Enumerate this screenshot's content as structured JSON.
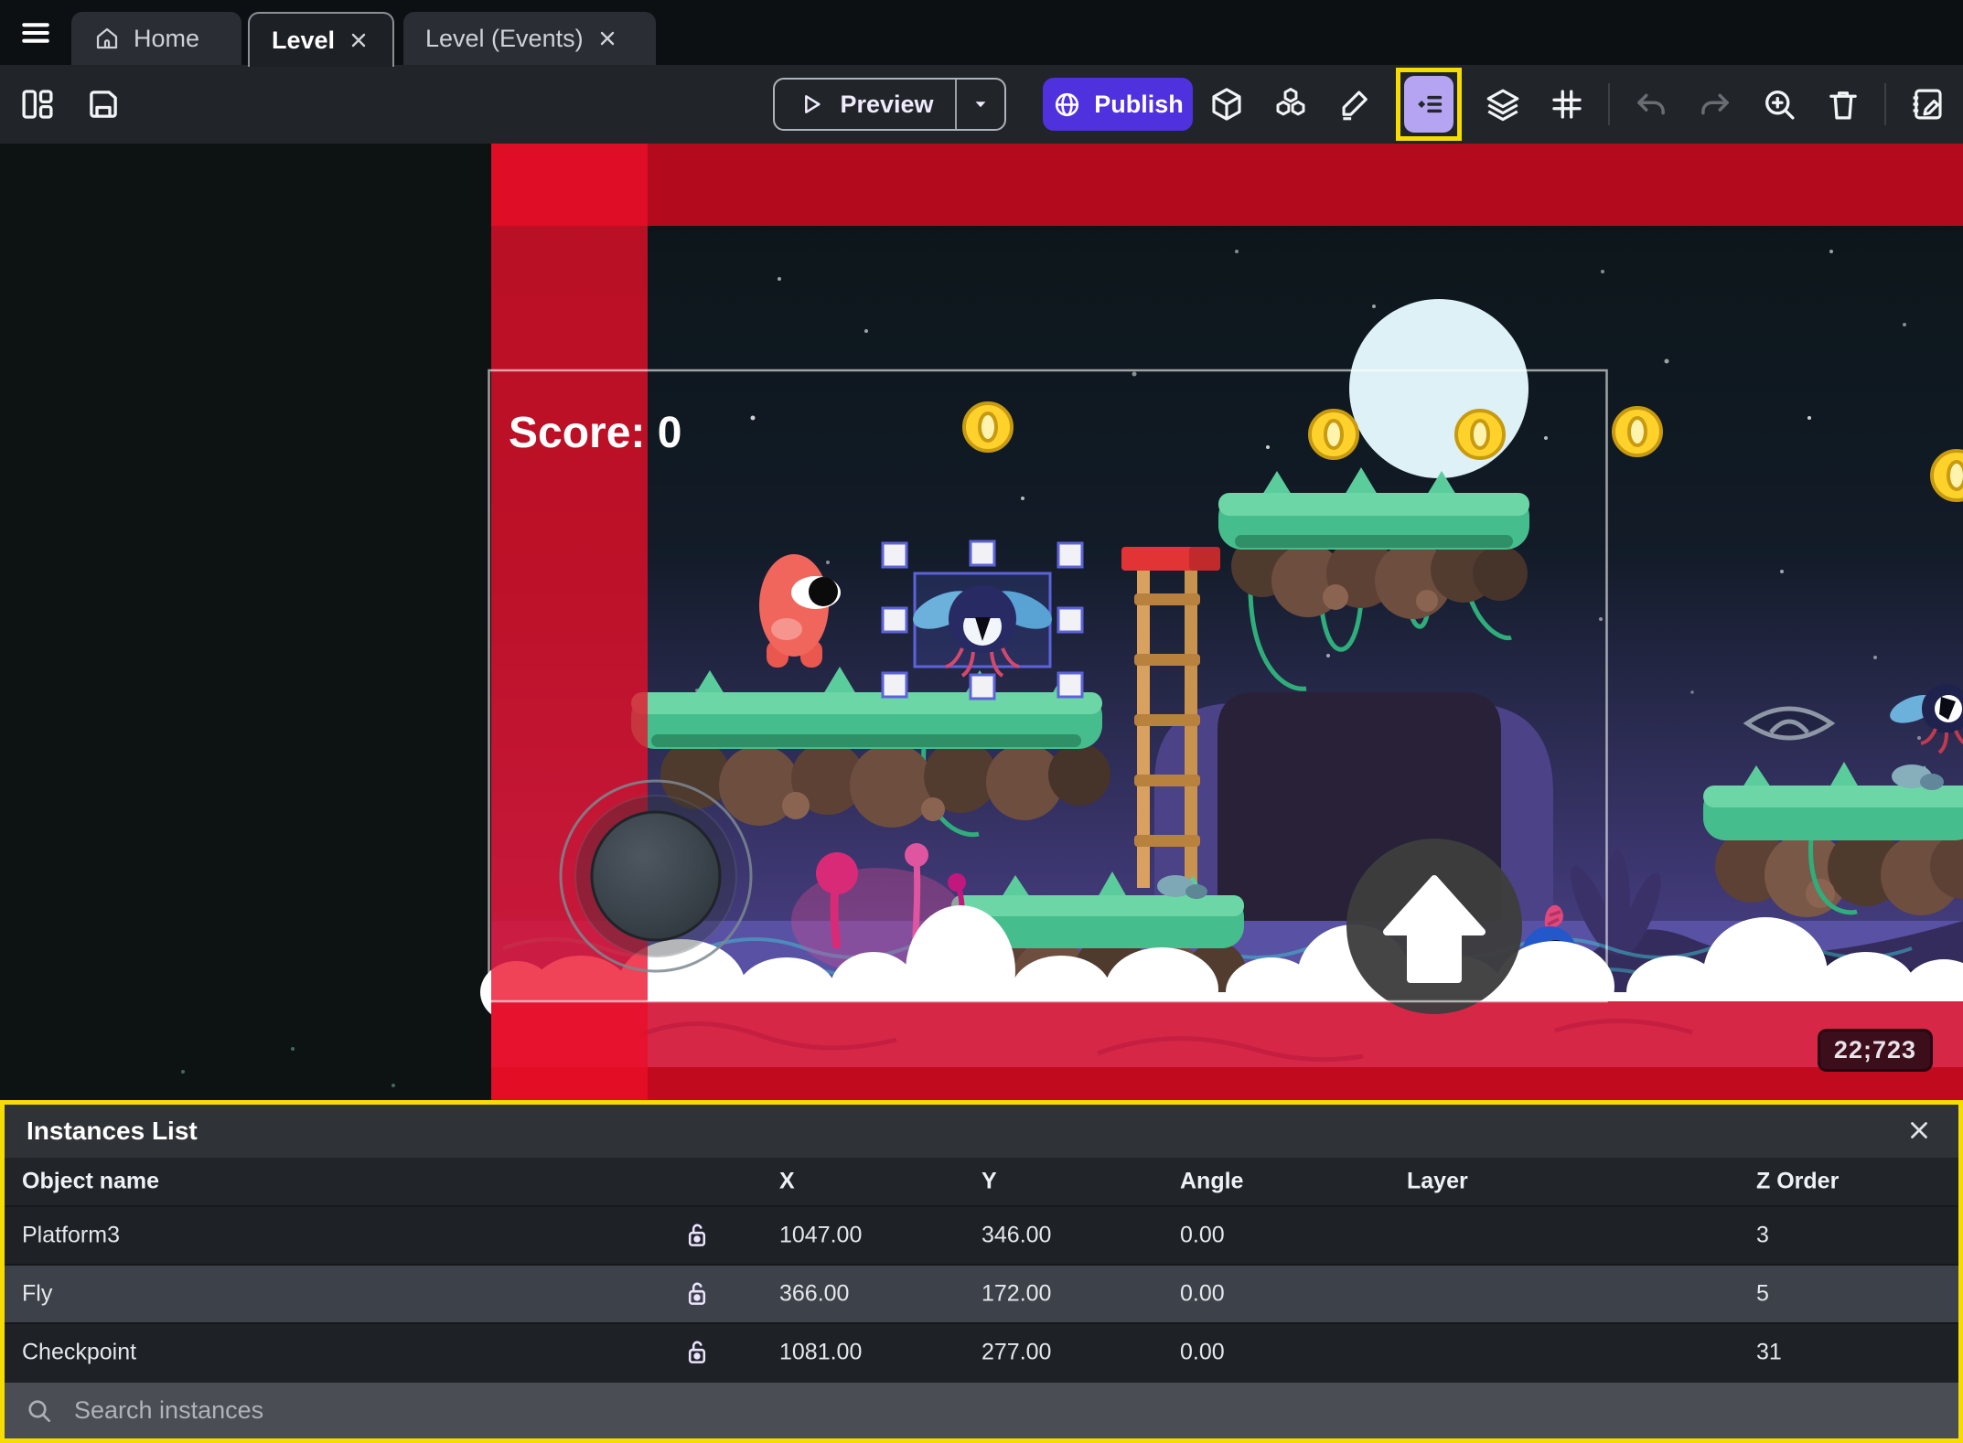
{
  "tabs": {
    "home": "Home",
    "level": "Level",
    "level_events": "Level (Events)"
  },
  "toolbar": {
    "preview_label": "Preview",
    "publish_label": "Publish"
  },
  "canvas": {
    "score_label": "Score: 0",
    "coords_badge": "22;723"
  },
  "instances_panel": {
    "title": "Instances List",
    "columns": [
      "Object name",
      "X",
      "Y",
      "Angle",
      "Layer",
      "Z Order"
    ],
    "rows": [
      {
        "name": "Platform3",
        "x": "1047.00",
        "y": "346.00",
        "angle": "0.00",
        "layer": "",
        "z_order": "3",
        "locked": false
      },
      {
        "name": "Fly",
        "x": "366.00",
        "y": "172.00",
        "angle": "0.00",
        "layer": "",
        "z_order": "5",
        "locked": false
      },
      {
        "name": "Checkpoint",
        "x": "1081.00",
        "y": "277.00",
        "angle": "0.00",
        "layer": "",
        "z_order": "31",
        "locked": false
      }
    ],
    "search_placeholder": "Search instances"
  },
  "colors": {
    "highlight_yellow": "#f6dc00",
    "publish_purple": "#4f31dd",
    "instances_icon_bg": "#b5a4f1",
    "selection_blue": "#5c63d8",
    "scene_red": "#c00a1f"
  }
}
